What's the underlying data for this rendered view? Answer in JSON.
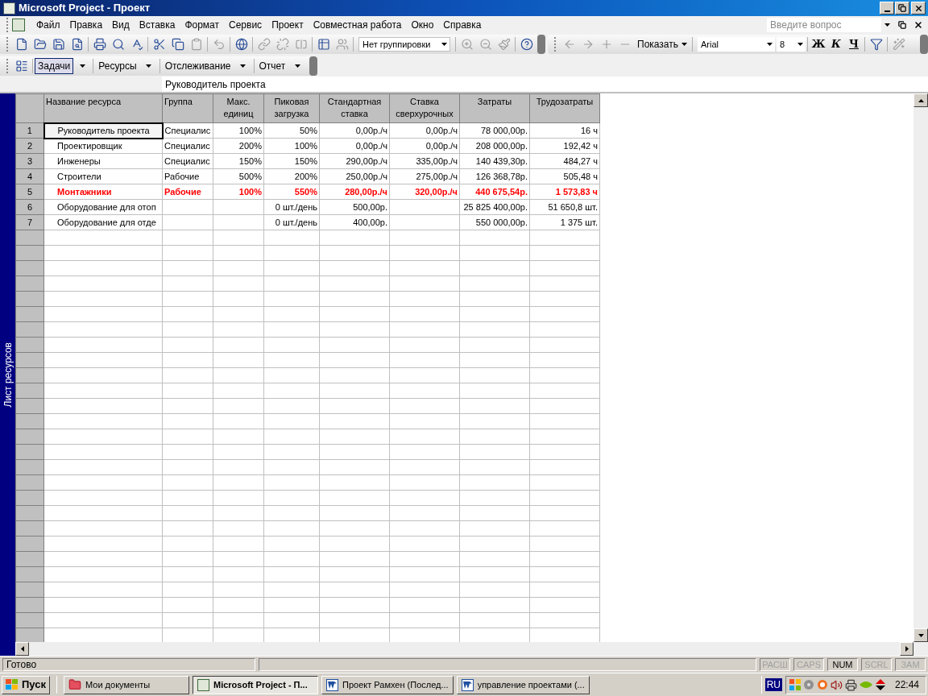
{
  "window": {
    "title": "Microsoft Project - Проект"
  },
  "menu": [
    "Файл",
    "Правка",
    "Вид",
    "Вставка",
    "Формат",
    "Сервис",
    "Проект",
    "Совместная работа",
    "Окно",
    "Справка"
  ],
  "help_search": {
    "placeholder": "Введите вопрос"
  },
  "standard_toolbar": {
    "grouping": "Нет группировки"
  },
  "formatting_toolbar": {
    "show": "Показать",
    "font": "Arial",
    "font_size": "8",
    "bold": "Ж",
    "italic": "К",
    "underline": "Ч"
  },
  "guide_toolbar": [
    {
      "label": "Задачи",
      "selected": true
    },
    {
      "label": "Ресурсы",
      "selected": false
    },
    {
      "label": "Отслеживание",
      "selected": false
    },
    {
      "label": "Отчет",
      "selected": false
    }
  ],
  "entry_bar": {
    "value": "Руководитель проекта"
  },
  "view_bar": {
    "label": "Лист ресурсов"
  },
  "table": {
    "columns": [
      "Название ресурса",
      "Группа",
      "Макс. единиц",
      "Пиковая загрузка",
      "Стандартная ставка",
      "Ставка сверхурочных",
      "Затраты",
      "Трудозатраты"
    ],
    "rows": [
      {
        "id": "1",
        "selected": true,
        "overallocated": false,
        "cells": [
          "Руководитель проекта",
          "Специалис",
          "100%",
          "50%",
          "0,00р./ч",
          "0,00р./ч",
          "78 000,00р.",
          "16 ч"
        ]
      },
      {
        "id": "2",
        "selected": false,
        "overallocated": false,
        "cells": [
          "Проектировщик",
          "Специалис",
          "200%",
          "100%",
          "0,00р./ч",
          "0,00р./ч",
          "208 000,00р.",
          "192,42 ч"
        ]
      },
      {
        "id": "3",
        "selected": false,
        "overallocated": false,
        "cells": [
          "Инженеры",
          "Специалис",
          "150%",
          "150%",
          "290,00р./ч",
          "335,00р./ч",
          "140 439,30р.",
          "484,27 ч"
        ]
      },
      {
        "id": "4",
        "selected": false,
        "overallocated": false,
        "cells": [
          "Строители",
          "Рабочие",
          "500%",
          "200%",
          "250,00р./ч",
          "275,00р./ч",
          "126 368,78р.",
          "505,48 ч"
        ]
      },
      {
        "id": "5",
        "selected": false,
        "overallocated": true,
        "cells": [
          "Монтажники",
          "Рабочие",
          "100%",
          "550%",
          "280,00р./ч",
          "320,00р./ч",
          "440 675,54р.",
          "1 573,83 ч"
        ]
      },
      {
        "id": "6",
        "selected": false,
        "overallocated": false,
        "cells": [
          "Оборудование для отоп",
          "",
          "",
          "0 шт./день",
          "500,00р.",
          "",
          "25 825 400,00р.",
          "51 650,8 шт."
        ]
      },
      {
        "id": "7",
        "selected": false,
        "overallocated": false,
        "cells": [
          "Оборудование для отде",
          "",
          "",
          "0 шт./день",
          "400,00р.",
          "",
          "550 000,00р.",
          "1 375 шт."
        ]
      }
    ]
  },
  "status_bar": {
    "text": "Готово",
    "indicators": [
      {
        "label": "РАСШ",
        "on": false
      },
      {
        "label": "CAPS",
        "on": false
      },
      {
        "label": "NUM",
        "on": true
      },
      {
        "label": "SCRL",
        "on": false
      },
      {
        "label": "ЗАМ",
        "on": false
      }
    ]
  },
  "taskbar": {
    "start": "Пуск",
    "tasks": [
      {
        "label": "Мои документы",
        "kind": "folder",
        "selected": false
      },
      {
        "label": "Microsoft Project - П...",
        "kind": "project",
        "selected": true
      },
      {
        "label": "Проект Рамхен (Послед...",
        "kind": "word",
        "selected": false
      },
      {
        "label": "управление проектами (...",
        "kind": "word",
        "selected": false
      }
    ],
    "language": "RU",
    "clock": "22:44"
  }
}
